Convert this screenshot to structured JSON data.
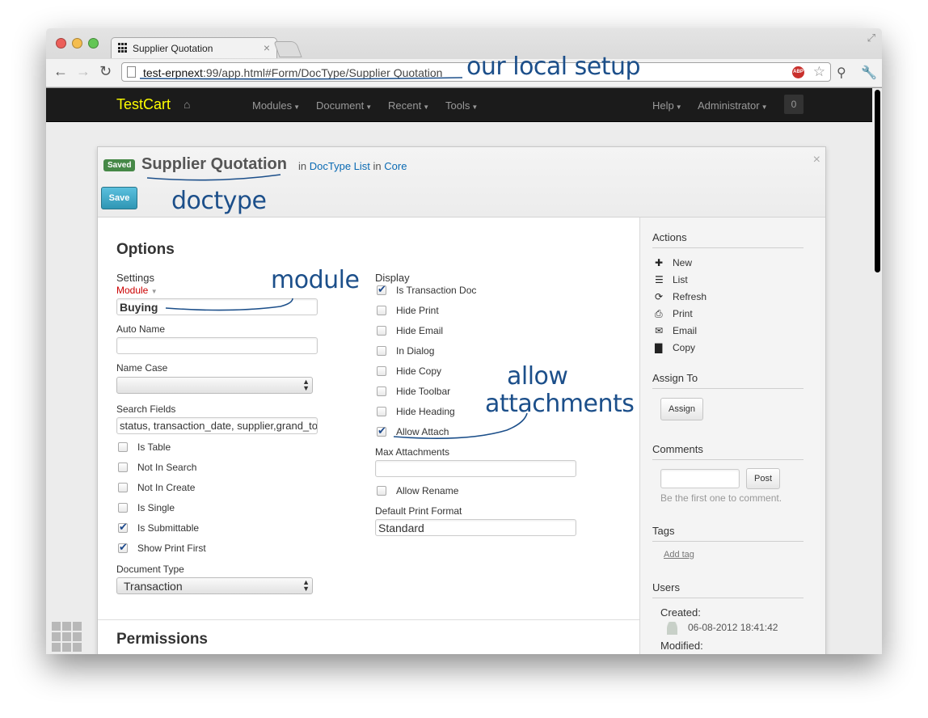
{
  "browser": {
    "tab_title": "Supplier Quotation",
    "tab_close": "×",
    "url_host": "test-erpnext",
    "url_rest": ":99/app.html#Form/DocType/Supplier Quotation",
    "abp_label": "ABP"
  },
  "navbar": {
    "brand": "TestCart",
    "menus": [
      "Modules",
      "Document",
      "Recent",
      "Tools"
    ],
    "help": "Help",
    "user": "Administrator",
    "notifications": "0"
  },
  "header": {
    "status_badge": "Saved",
    "title": "Supplier Quotation",
    "in1": "in",
    "crumb1": "DocType List",
    "in2": "in",
    "crumb2": "Core",
    "close": "×",
    "save_label": "Save"
  },
  "form": {
    "section_options": "Options",
    "settings_heading": "Settings",
    "module_label": "Module",
    "module_value": "Buying",
    "auto_name_label": "Auto Name",
    "auto_name_value": "",
    "name_case_label": "Name Case",
    "name_case_value": "",
    "search_fields_label": "Search Fields",
    "search_fields_value": "status, transaction_date, supplier,grand_total",
    "left_checks": [
      {
        "label": "Is Table",
        "checked": false
      },
      {
        "label": "Not In Search",
        "checked": false
      },
      {
        "label": "Not In Create",
        "checked": false
      },
      {
        "label": "Is Single",
        "checked": false
      },
      {
        "label": "Is Submittable",
        "checked": true
      },
      {
        "label": "Show Print First",
        "checked": true
      }
    ],
    "document_type_label": "Document Type",
    "document_type_value": "Transaction",
    "display_heading": "Display",
    "right_checks": [
      {
        "label": "Is Transaction Doc",
        "checked": true
      },
      {
        "label": "Hide Print",
        "checked": false
      },
      {
        "label": "Hide Email",
        "checked": false
      },
      {
        "label": "In Dialog",
        "checked": false
      },
      {
        "label": "Hide Copy",
        "checked": false
      },
      {
        "label": "Hide Toolbar",
        "checked": false
      },
      {
        "label": "Hide Heading",
        "checked": false
      },
      {
        "label": "Allow Attach",
        "checked": true
      }
    ],
    "max_attachments_label": "Max Attachments",
    "max_attachments_value": "",
    "allow_rename_label": "Allow Rename",
    "allow_rename_checked": false,
    "default_print_format_label": "Default Print Format",
    "default_print_format_value": "Standard",
    "section_permissions": "Permissions"
  },
  "sidebar": {
    "actions_heading": "Actions",
    "actions": [
      {
        "icon": "plus-icon",
        "label": "New"
      },
      {
        "icon": "list-icon",
        "label": "List"
      },
      {
        "icon": "refresh-icon",
        "label": "Refresh"
      },
      {
        "icon": "print-icon",
        "label": "Print"
      },
      {
        "icon": "email-icon",
        "label": "Email"
      },
      {
        "icon": "copy-icon",
        "label": "Copy"
      }
    ],
    "assign_heading": "Assign To",
    "assign_button": "Assign",
    "comments_heading": "Comments",
    "post_button": "Post",
    "comments_empty": "Be the first one to comment.",
    "tags_heading": "Tags",
    "add_tag": "Add tag",
    "users_heading": "Users",
    "created_label": "Created:",
    "created_value": "06-08-2012 18:41:42",
    "modified_label": "Modified:"
  },
  "annotations": {
    "local_setup": "our local setup",
    "doctype": "doctype",
    "module": "module",
    "allow": "allow",
    "attachments": "attachments"
  },
  "colors": {
    "brand": "#ffff00",
    "badge_saved": "#468847",
    "save_button": "#2f96b4",
    "annotation_ink": "#1c4f8a",
    "required_label": "#cc0000"
  }
}
